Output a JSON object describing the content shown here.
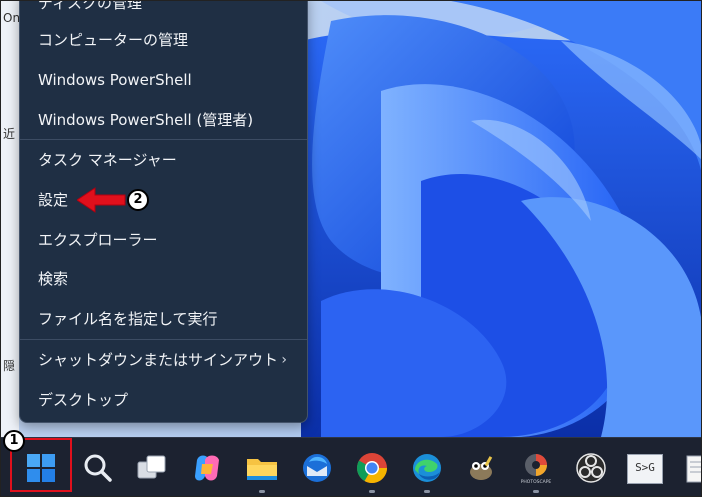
{
  "desktop": {
    "left_labels": [
      "On",
      "近",
      "隠"
    ]
  },
  "menu": {
    "items": [
      {
        "label": "ディスクの管理"
      },
      {
        "label": "コンピューターの管理"
      },
      {
        "label": "Windows PowerShell"
      },
      {
        "label": "Windows PowerShell (管理者)"
      },
      {
        "label": "タスク マネージャー"
      },
      {
        "label": "設定"
      },
      {
        "label": "エクスプローラー"
      },
      {
        "label": "検索"
      },
      {
        "label": "ファイル名を指定して実行"
      },
      {
        "label": "シャットダウンまたはサインアウト",
        "submenu_glyph": "›"
      },
      {
        "label": "デスクトップ"
      }
    ]
  },
  "annotations": {
    "step1": "1",
    "step2": "2",
    "highlight_color": "#e0101c",
    "arrow_color": "#e0101c"
  },
  "taskbar": {
    "icons": [
      "windows-start-icon",
      "search-icon",
      "task-view-icon",
      "copilot-icon",
      "file-explorer-icon",
      "thunderbird-icon",
      "chrome-icon",
      "edge-icon",
      "gimp-icon",
      "photoscape-icon",
      "obs-icon",
      "text-converter-icon",
      "notepad-icon"
    ],
    "app_label_sg": "S>G",
    "photoscape_label": "PHOTOSCAPE"
  },
  "colors": {
    "menu_bg": "#1f2f44",
    "taskbar_bg": "#1c2230",
    "accent_blue": "#1a5cf0"
  }
}
